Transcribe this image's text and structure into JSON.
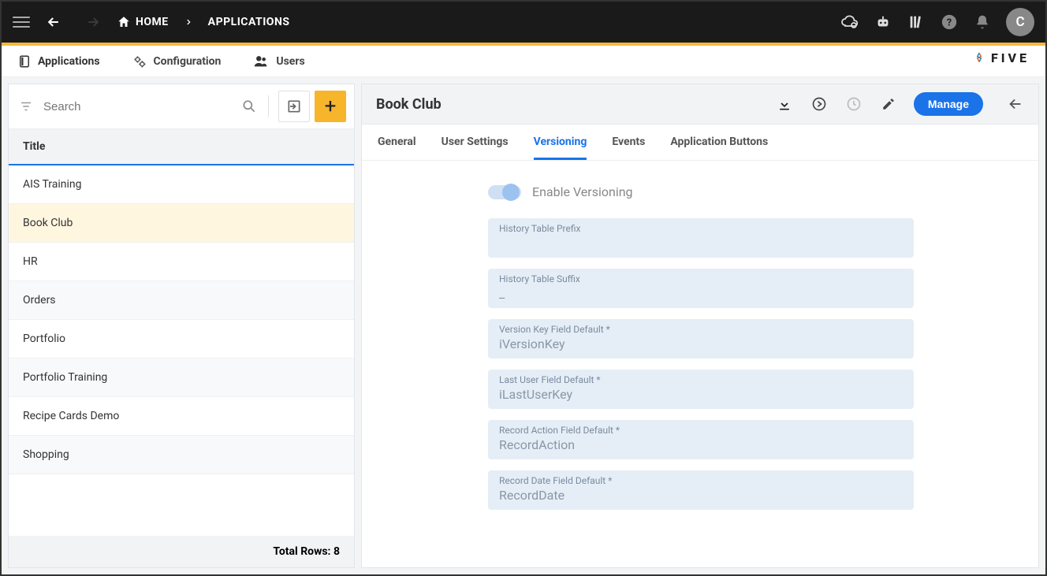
{
  "topbar": {
    "home_label": "HOME",
    "crumb": "APPLICATIONS",
    "avatar_letter": "C"
  },
  "subnav": {
    "applications": "Applications",
    "configuration": "Configuration",
    "users": "Users",
    "logo_text": "FIVE"
  },
  "search": {
    "placeholder": "Search"
  },
  "list": {
    "header": "Title",
    "items": [
      "AIS Training",
      "Book Club",
      "HR",
      "Orders",
      "Portfolio",
      "Portfolio Training",
      "Recipe Cards Demo",
      "Shopping"
    ],
    "footer": "Total Rows: 8",
    "selected_index": 1
  },
  "detail": {
    "title": "Book Club",
    "manage_label": "Manage",
    "tabs": [
      "General",
      "User Settings",
      "Versioning",
      "Events",
      "Application Buttons"
    ],
    "active_tab_index": 2,
    "versioning": {
      "toggle_label": "Enable Versioning",
      "fields": [
        {
          "label": "History Table Prefix",
          "value": ""
        },
        {
          "label": "History Table Suffix",
          "value": "_"
        },
        {
          "label": "Version Key Field Default *",
          "value": "iVersionKey"
        },
        {
          "label": "Last User Field Default *",
          "value": "iLastUserKey"
        },
        {
          "label": "Record Action Field Default *",
          "value": "RecordAction"
        },
        {
          "label": "Record Date Field Default *",
          "value": "RecordDate"
        }
      ]
    }
  }
}
